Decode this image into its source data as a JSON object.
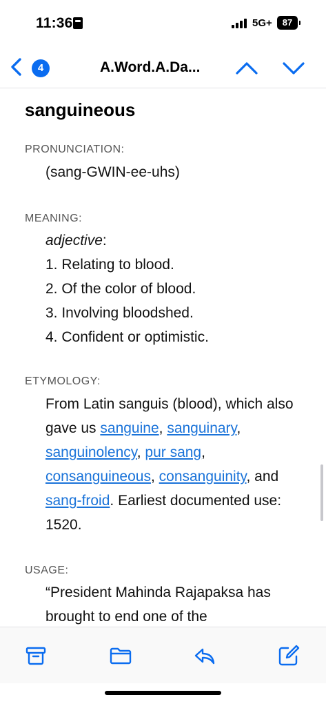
{
  "status_bar": {
    "time": "11:36",
    "network": "5G+",
    "battery": "87"
  },
  "nav": {
    "badge_count": "4",
    "title": "A.Word.A.Da...",
    "accent_color": "#0a6cf0"
  },
  "entry": {
    "word": "sanguineous",
    "pronunciation_label": "PRONUNCIATION:",
    "pronunciation": "(sang-GWIN-ee-uhs)",
    "meaning_label": "MEANING:",
    "part_of_speech": "adjective",
    "meanings": [
      "1. Relating to blood.",
      "2. Of the color of blood.",
      "3. Involving bloodshed.",
      "4. Confident or optimistic."
    ],
    "etymology_label": "ETYMOLOGY:",
    "etymology": {
      "intro": "From Latin sanguis (blood), which also gave us ",
      "links": [
        "sanguine",
        "sanguinary",
        "sanguinolency",
        "pur sang",
        "consanguineous",
        "consanguinity",
        "sang-froid"
      ],
      "and_word": ", and ",
      "outro": "Earliest documented use: 1520."
    },
    "usage_label": "USAGE:",
    "usage": "“President Mahinda Rajapaksa has brought to end one of the"
  },
  "toolbar": {
    "icons": [
      "archive-icon",
      "folder-icon",
      "reply-icon",
      "compose-icon"
    ]
  },
  "colors": {
    "link": "#1a73d9",
    "label": "#555555"
  }
}
